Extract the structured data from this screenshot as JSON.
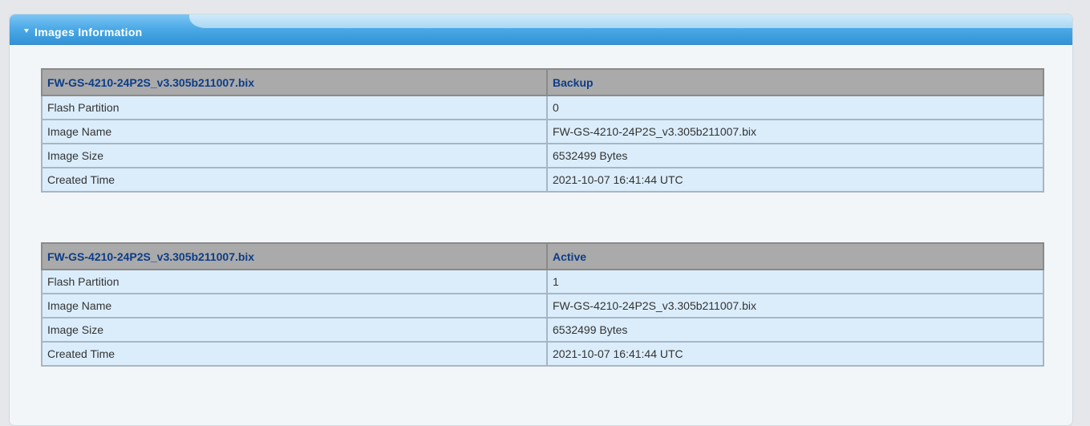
{
  "panel": {
    "title": "Images Information"
  },
  "images": [
    {
      "file": "FW-GS-4210-24P2S_v3.305b211007.bix",
      "status": "Backup",
      "rows": [
        {
          "label": "Flash Partition",
          "value": "0"
        },
        {
          "label": "Image Name",
          "value": "FW-GS-4210-24P2S_v3.305b211007.bix"
        },
        {
          "label": "Image Size",
          "value": "6532499 Bytes"
        },
        {
          "label": "Created Time",
          "value": "2021-10-07 16:41:44 UTC"
        }
      ]
    },
    {
      "file": "FW-GS-4210-24P2S_v3.305b211007.bix",
      "status": "Active",
      "rows": [
        {
          "label": "Flash Partition",
          "value": "1"
        },
        {
          "label": "Image Name",
          "value": "FW-GS-4210-24P2S_v3.305b211007.bix"
        },
        {
          "label": "Image Size",
          "value": "6532499 Bytes"
        },
        {
          "label": "Created Time",
          "value": "2021-10-07 16:41:44 UTC"
        }
      ]
    }
  ],
  "colors": {
    "header_gradient_top": "#7cc6f4",
    "header_gradient_bottom": "#3393d6",
    "table_header_bg": "#aaaaaa",
    "table_header_text": "#0d3d88",
    "table_cell_bg": "#dbedfb"
  },
  "icons": {
    "collapse": "caret-down-icon"
  }
}
